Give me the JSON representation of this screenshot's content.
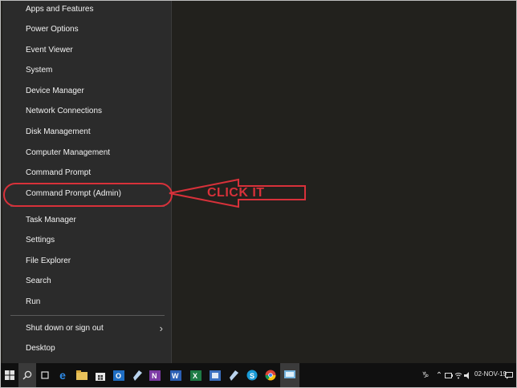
{
  "menu": {
    "items": [
      {
        "label": "Apps and Features"
      },
      {
        "label": "Power Options"
      },
      {
        "label": "Event Viewer"
      },
      {
        "label": "System"
      },
      {
        "label": "Device Manager"
      },
      {
        "label": "Network Connections"
      },
      {
        "label": "Disk Management"
      },
      {
        "label": "Computer Management"
      },
      {
        "label": "Command Prompt"
      },
      {
        "label": "Command Prompt (Admin)"
      },
      {
        "label": "Task Manager"
      },
      {
        "label": "Settings"
      },
      {
        "label": "File Explorer"
      },
      {
        "label": "Search"
      },
      {
        "label": "Run"
      },
      {
        "label": "Shut down or sign out"
      },
      {
        "label": "Desktop"
      }
    ]
  },
  "annotation": {
    "label": "CLICK IT",
    "color": "#d8313a"
  },
  "taskbar": {
    "icons": [
      "windows-start-icon",
      "search-icon",
      "task-view-icon",
      "edge-icon",
      "file-explorer-icon",
      "store-icon",
      "outlook-icon",
      "pen-icon",
      "onenote-icon",
      "word-icon",
      "excel-icon",
      "visio-icon",
      "pen2-icon",
      "skype-icon",
      "chrome-icon",
      "remote-desktop-icon"
    ],
    "tray": {
      "date": "02-NOV-19"
    }
  }
}
